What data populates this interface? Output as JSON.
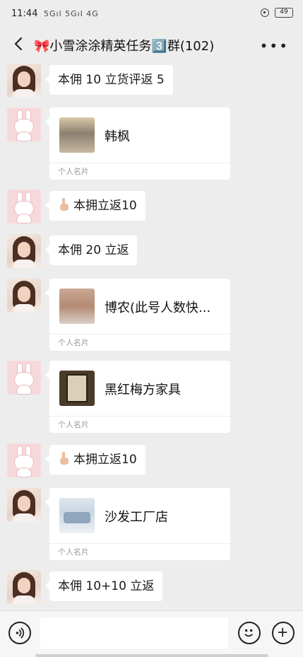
{
  "status": {
    "time": "11:44",
    "signal": "5Gıl 5Gıl 4G",
    "battery": "49"
  },
  "header": {
    "title": "🎀小雪涂涂精英任务3️⃣群(102)"
  },
  "messages": [
    {
      "type": "text",
      "sender": "woman",
      "text": "本佣 10 立货评返 5"
    },
    {
      "type": "card",
      "sender": "bunny",
      "name": "韩枫",
      "footer": "个人名片"
    },
    {
      "type": "text",
      "sender": "bunny",
      "text": "本拥立返10"
    },
    {
      "type": "text",
      "sender": "woman",
      "text": "本佣 20 立返"
    },
    {
      "type": "card",
      "sender": "woman",
      "name": "博农(此号人数快...",
      "footer": "个人名片"
    },
    {
      "type": "card",
      "sender": "bunny",
      "name": "黑红梅方家具",
      "footer": "个人名片"
    },
    {
      "type": "text",
      "sender": "bunny",
      "text": "本拥立返10"
    },
    {
      "type": "card",
      "sender": "woman",
      "name": "沙发工厂店",
      "footer": "个人名片"
    },
    {
      "type": "text",
      "sender": "woman",
      "text": "本佣 10+10 立返"
    }
  ],
  "icons": [
    "back-icon",
    "more-icon",
    "voice-icon",
    "emoji-icon",
    "plus-icon",
    "pointing-finger-icon"
  ]
}
